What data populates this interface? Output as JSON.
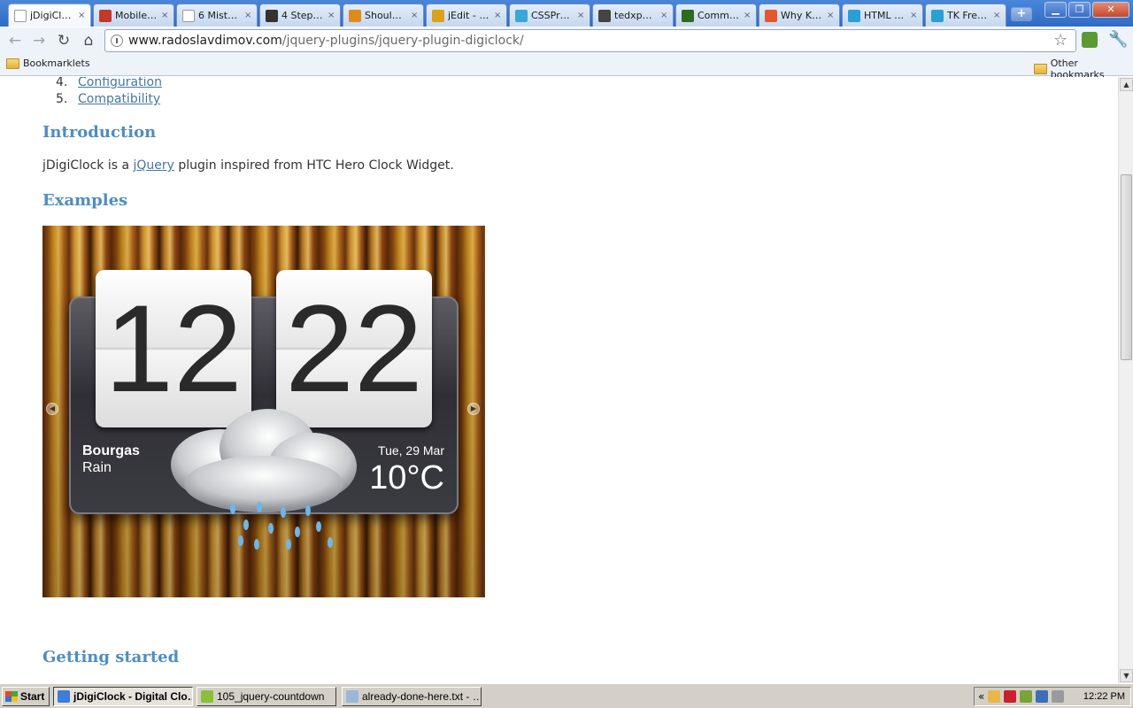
{
  "browser": {
    "tabs": [
      {
        "title": "jDigiCl…",
        "active": true,
        "icon": "page-icon",
        "color": "#ffffff"
      },
      {
        "title": "Mobile…",
        "icon": "star-favicon",
        "color": "#c0392b"
      },
      {
        "title": "6 Mist…",
        "icon": "page-icon",
        "color": "#ffffff"
      },
      {
        "title": "4 Step…",
        "icon": "sr-favicon",
        "color": "#333333"
      },
      {
        "title": "Shoul…",
        "icon": "bookmark-favicon",
        "color": "#e08a1e"
      },
      {
        "title": "jEdit - …",
        "icon": "jedit-favicon",
        "color": "#d9a21b"
      },
      {
        "title": "CSSPr…",
        "icon": "i-favicon",
        "color": "#3aa7d8"
      },
      {
        "title": "tedxp…",
        "icon": "tedx-favicon",
        "color": "#444444"
      },
      {
        "title": "Comm…",
        "icon": "comm-favicon",
        "color": "#2d6b1f"
      },
      {
        "title": "Why K…",
        "icon": "flame-favicon",
        "color": "#e4572e"
      },
      {
        "title": "HTML …",
        "icon": "html-favicon",
        "color": "#2a9fd6"
      },
      {
        "title": "TK Fre…",
        "icon": "tk-favicon",
        "color": "#2a9fd6"
      }
    ],
    "tab_close": "×",
    "new_tab": "+",
    "window_buttons": {
      "minimize": "▁",
      "maximize": "❐",
      "close": "✕"
    },
    "url_host": "www.radoslavdimov.com",
    "url_path": "/jquery-plugins/jquery-plugin-digiclock/",
    "bookmarks_left": "Bookmarklets",
    "bookmarks_right": "Other bookmarks"
  },
  "page": {
    "toc": [
      {
        "num": "4.",
        "label": "Configuration"
      },
      {
        "num": "5.",
        "label": "Compatibility"
      }
    ],
    "introduction_heading": "Introduction",
    "intro_before": "jDigiClock is a ",
    "intro_link": "jQuery",
    "intro_after": " plugin inspired from HTC Hero Clock Widget.",
    "examples_heading": "Examples",
    "getting_started_heading": "Getting started",
    "clock": {
      "hours": "12",
      "minutes": "22",
      "city": "Bourgas",
      "condition": "Rain",
      "date": "Tue, 29 Mar",
      "temperature": "10°C",
      "prev_arrow": "◀",
      "next_arrow": "▶"
    }
  },
  "taskbar": {
    "start": "Start",
    "tasks": [
      {
        "label": "jDigiClock - Digital Clo…",
        "active": true,
        "color": "#3d7ed8"
      },
      {
        "label": "105_jquery-countdown",
        "active": false,
        "color": "#8bbf3a"
      },
      {
        "label": "already-done-here.txt - …",
        "active": false,
        "color": "#9bb7d8"
      }
    ],
    "tray_collapse": "«",
    "time": "12:22 PM"
  },
  "colors": {
    "heading": "#4f8dbf",
    "link": "#4576a5"
  }
}
